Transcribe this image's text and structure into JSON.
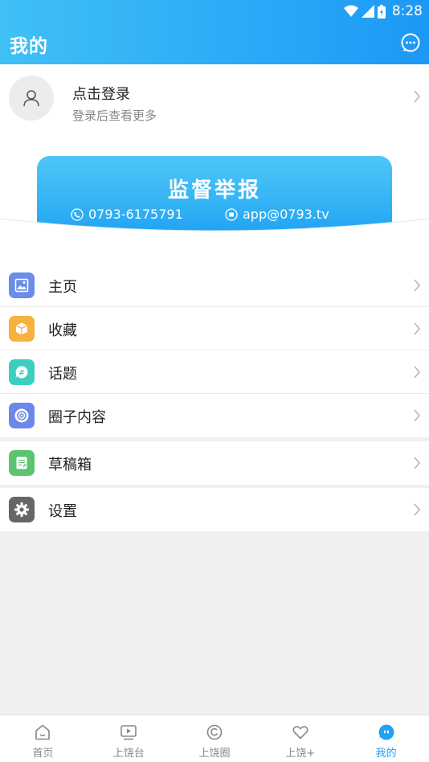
{
  "status_bar": {
    "time": "8:28"
  },
  "header": {
    "title": "我的"
  },
  "profile": {
    "title": "点击登录",
    "subtitle": "登录后查看更多"
  },
  "banner": {
    "title": "监督举报",
    "phone": "0793-6175791",
    "email": "app@0793.tv"
  },
  "menu_group_1": [
    {
      "label": "主页",
      "icon": "image-icon",
      "color": "#6a8ee8"
    },
    {
      "label": "收藏",
      "icon": "box-icon",
      "color": "#f7b13d"
    },
    {
      "label": "话题",
      "icon": "hashtag-icon",
      "color": "#3ccfbf"
    },
    {
      "label": "圈子内容",
      "icon": "circle-icon",
      "color": "#6d86e8"
    }
  ],
  "menu_group_2": [
    {
      "label": "草稿箱",
      "icon": "draft-icon",
      "color": "#5cc36f"
    }
  ],
  "menu_group_3": [
    {
      "label": "设置",
      "icon": "gear-icon",
      "color": "#666666"
    }
  ],
  "tabbar": [
    {
      "label": "首页",
      "icon": "home-icon",
      "active": false
    },
    {
      "label": "上饶台",
      "icon": "tv-icon",
      "active": false
    },
    {
      "label": "上饶圈",
      "icon": "circle-icon",
      "active": false
    },
    {
      "label": "上饶+",
      "icon": "heart-icon",
      "active": false
    },
    {
      "label": "我的",
      "icon": "me-icon",
      "active": true
    }
  ],
  "colors": {
    "accent": "#22a0f5",
    "header": "#2aa9f7"
  }
}
